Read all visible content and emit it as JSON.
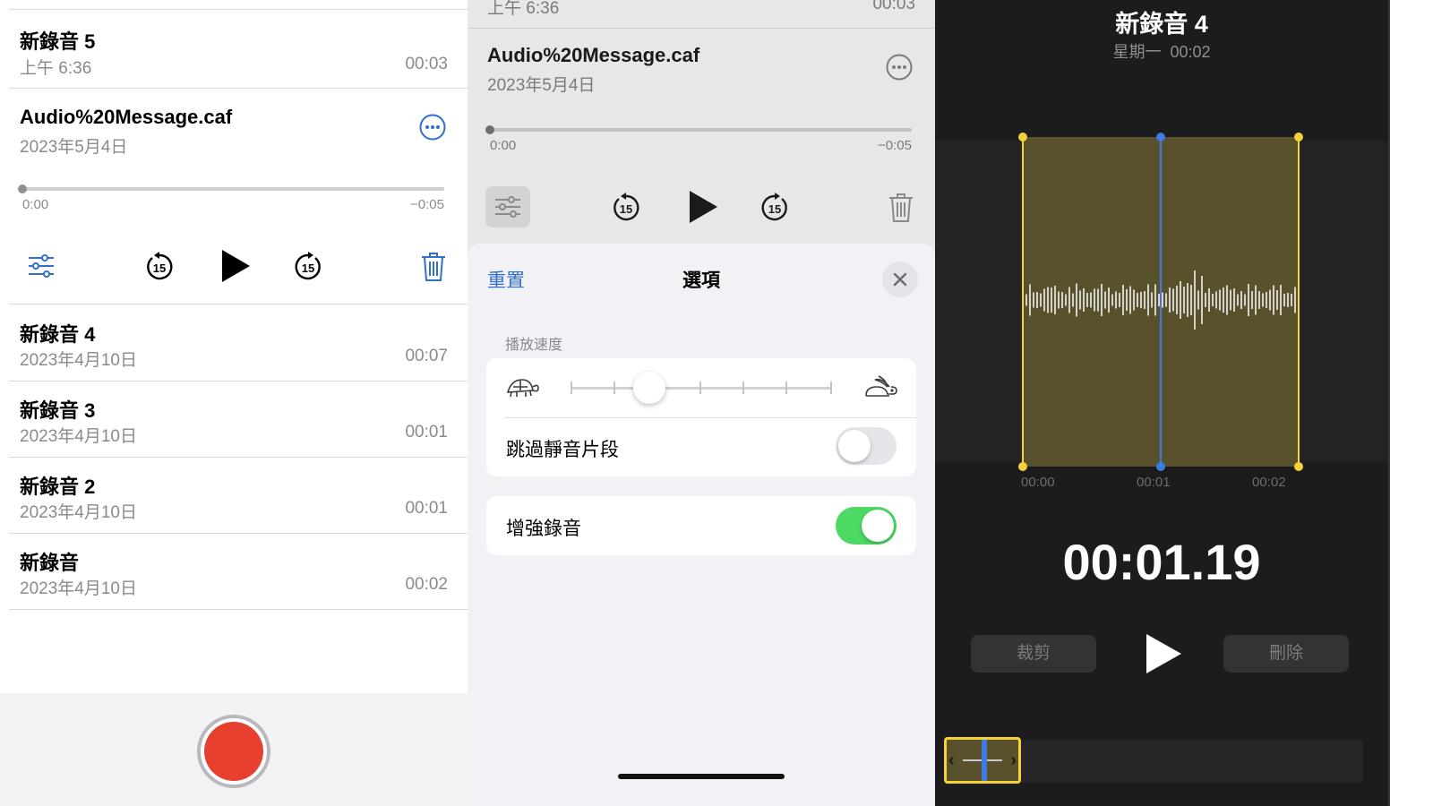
{
  "list_screen": {
    "recordings": [
      {
        "title": "新錄音 5",
        "date": "上午 6:36",
        "duration": "00:03"
      },
      {
        "title": "Audio%20Message.caf",
        "date": "2023年5月4日",
        "duration": ""
      },
      {
        "title": "新錄音 4",
        "date": "2023年4月10日",
        "duration": "00:07"
      },
      {
        "title": "新錄音 3",
        "date": "2023年4月10日",
        "duration": "00:01"
      },
      {
        "title": "新錄音 2",
        "date": "2023年4月10日",
        "duration": "00:01"
      },
      {
        "title": "新錄音",
        "date": "2023年4月10日",
        "duration": "00:02"
      }
    ],
    "player": {
      "elapsed": "0:00",
      "remaining": "−0:05",
      "skip_back": "15",
      "skip_forward": "15"
    },
    "icons": {
      "more": "ellipsis-circle-icon",
      "options": "sliders-icon",
      "delete": "trash-icon",
      "record": "record-button-icon"
    },
    "accent_color": "#2f6fd0",
    "record_color": "#e8402f"
  },
  "options_screen": {
    "background_row": {
      "date": "上午 6:36",
      "duration": "00:03"
    },
    "recording": {
      "title": "Audio%20Message.caf",
      "date": "2023年5月4日"
    },
    "player": {
      "elapsed": "0:00",
      "remaining": "−0:05",
      "skip_back": "15",
      "skip_forward": "15"
    },
    "sheet": {
      "reset_label": "重置",
      "title": "選項",
      "speed_section_label": "播放速度",
      "speed_level": 0.2,
      "skip_silence_label": "跳過靜音片段",
      "skip_silence_on": false,
      "enhance_label": "增強錄音",
      "enhance_on": true
    },
    "toggle_on_color": "#4cd964"
  },
  "edit_screen": {
    "title": "新錄音 4",
    "subtitle_day": "星期一",
    "subtitle_time": "00:02",
    "ruler_labels": [
      "00:00",
      "00:01",
      "00:02"
    ],
    "time_display": "00:01.19",
    "trim_label": "裁剪",
    "delete_label": "刪除",
    "selection_color": "#f6d13a",
    "playhead_color": "#3d7be0"
  }
}
